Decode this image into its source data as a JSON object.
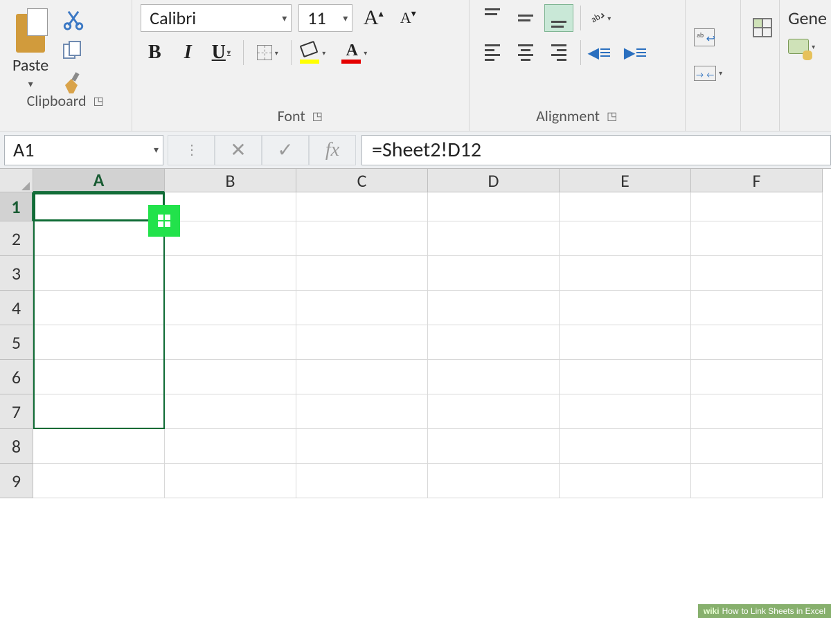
{
  "ribbon": {
    "clipboard": {
      "group_label": "Clipboard",
      "paste": "Paste"
    },
    "font": {
      "group_label": "Font",
      "name": "Calibri",
      "size": "11",
      "increase": "A",
      "decrease": "A",
      "bold": "B",
      "italic": "I",
      "underline": "U",
      "fontcolor_glyph": "A"
    },
    "alignment": {
      "group_label": "Alignment"
    },
    "number": {
      "format_label": "Gene"
    }
  },
  "formula_bar": {
    "name_box": "A1",
    "fx_label": "fx",
    "formula": "=Sheet2!D12"
  },
  "grid": {
    "columns": [
      "A",
      "B",
      "C",
      "D",
      "E",
      "F"
    ],
    "rows": [
      "1",
      "2",
      "3",
      "4",
      "5",
      "6",
      "7",
      "8",
      "9"
    ],
    "selected_column_index": 0,
    "selected_row_index": 0
  },
  "watermark": {
    "brand": "wiki",
    "suffix": "How",
    "text": " to Link Sheets in Excel"
  }
}
